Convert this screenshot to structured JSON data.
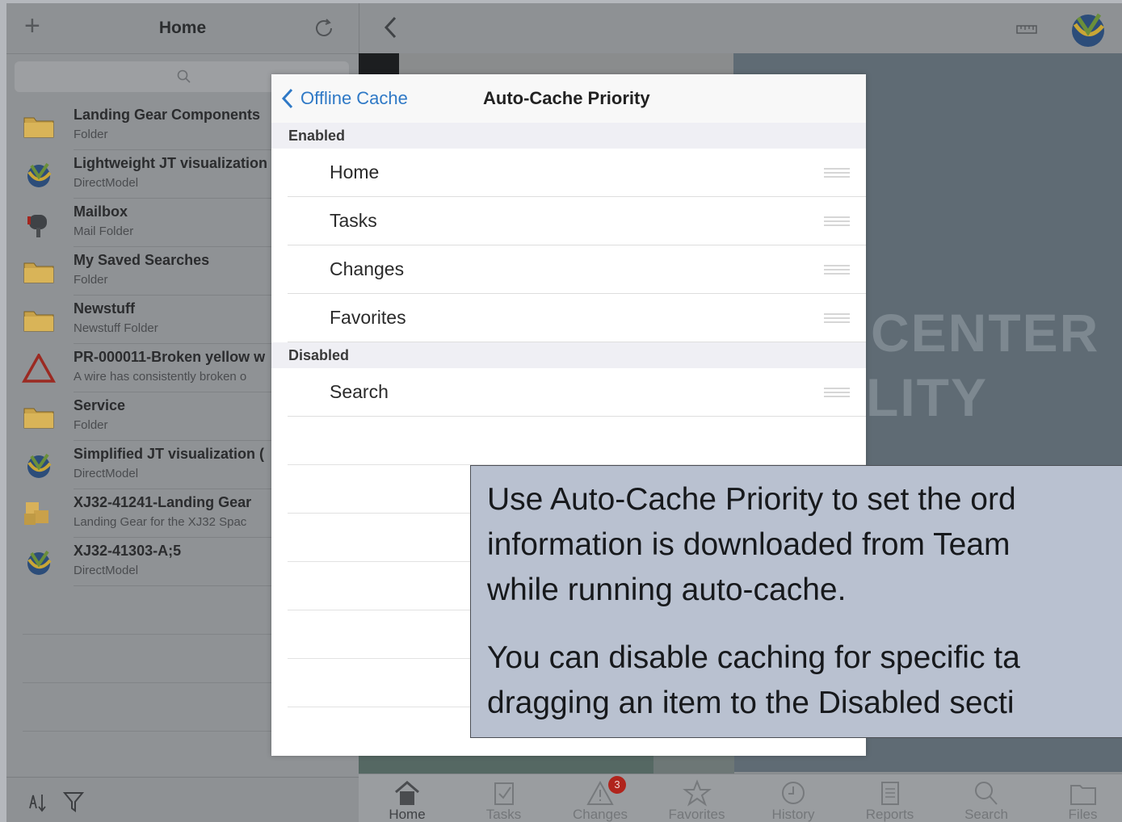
{
  "sidebar": {
    "title": "Home",
    "items": [
      {
        "title": "Landing Gear Components",
        "subtitle": "Folder",
        "icon": "folder-icon"
      },
      {
        "title": "Lightweight JT visualization",
        "subtitle": "DirectModel",
        "icon": "jt-model-icon"
      },
      {
        "title": "Mailbox",
        "subtitle": "Mail Folder",
        "icon": "mailbox-icon"
      },
      {
        "title": "My Saved Searches",
        "subtitle": "Folder",
        "icon": "folder-icon"
      },
      {
        "title": "Newstuff",
        "subtitle": "Newstuff Folder",
        "icon": "folder-icon"
      },
      {
        "title": "PR-000011-Broken yellow w",
        "subtitle": "A wire has consistently broken o",
        "icon": "problem-report-icon"
      },
      {
        "title": "Service",
        "subtitle": "Folder",
        "icon": "folder-icon"
      },
      {
        "title": "Simplified JT visualization (",
        "subtitle": "DirectModel",
        "icon": "jt-model-icon"
      },
      {
        "title": "XJ32-41241-Landing Gear",
        "subtitle": "Landing Gear for the XJ32 Spac",
        "icon": "item-box-icon"
      },
      {
        "title": "XJ32-41303-A;5",
        "subtitle": "DirectModel",
        "icon": "jt-model-icon"
      }
    ]
  },
  "background_text": {
    "line1": "CENTER",
    "line2": "LITY"
  },
  "popover": {
    "back_label": "Offline Cache",
    "title": "Auto-Cache Priority",
    "enabled_header": "Enabled",
    "enabled_items": [
      "Home",
      "Tasks",
      "Changes",
      "Favorites"
    ],
    "disabled_header": "Disabled",
    "disabled_items": [
      "Search"
    ]
  },
  "callout": {
    "paragraph1_lines": [
      "Use Auto-Cache Priority to set the ord",
      "information is downloaded from Team",
      "while running auto-cache."
    ],
    "paragraph2_lines": [
      "You can disable caching for specific ta",
      "dragging an item to the Disabled secti"
    ]
  },
  "tabbar": {
    "tabs": [
      {
        "label": "Home",
        "icon": "home-icon",
        "active": true
      },
      {
        "label": "Tasks",
        "icon": "tasks-icon",
        "active": false
      },
      {
        "label": "Changes",
        "icon": "changes-icon",
        "active": false,
        "badge": "3"
      },
      {
        "label": "Favorites",
        "icon": "star-icon",
        "active": false
      },
      {
        "label": "History",
        "icon": "clock-icon",
        "active": false
      },
      {
        "label": "Reports",
        "icon": "reports-icon",
        "active": false
      },
      {
        "label": "Search",
        "icon": "search-icon",
        "active": false
      },
      {
        "label": "Files",
        "icon": "files-icon",
        "active": false
      }
    ]
  },
  "colors": {
    "accent": "#2f79c6",
    "badge": "#b0241c",
    "callout_bg": "#b9c1d0"
  }
}
